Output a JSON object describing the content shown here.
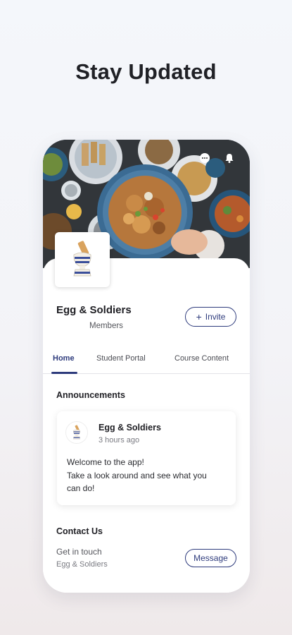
{
  "headline": "Stay Updated",
  "top_icons": [
    "chat-icon",
    "bell-icon"
  ],
  "group": {
    "name": "Egg & Soldiers",
    "members_label": "Members",
    "invite_label": "Invite",
    "invite_icon": "plus-icon"
  },
  "tabs": [
    {
      "label": "Home",
      "active": true
    },
    {
      "label": "Student Portal",
      "active": false
    },
    {
      "label": "Course Content",
      "active": false
    }
  ],
  "announcements": {
    "title": "Announcements",
    "post": {
      "author": "Egg & Soldiers",
      "time": "3 hours ago",
      "lines": [
        "Welcome to the app!",
        "Take a look around and see what you",
        "can do!"
      ]
    }
  },
  "contact": {
    "title": "Contact Us",
    "subtitle": "Get in touch",
    "name": "Egg & Soldiers",
    "message_label": "Message"
  },
  "colors": {
    "accent": "#2e3b7c",
    "egg_stripe": "#3b4f9a",
    "soldier": "#d9a35e"
  }
}
